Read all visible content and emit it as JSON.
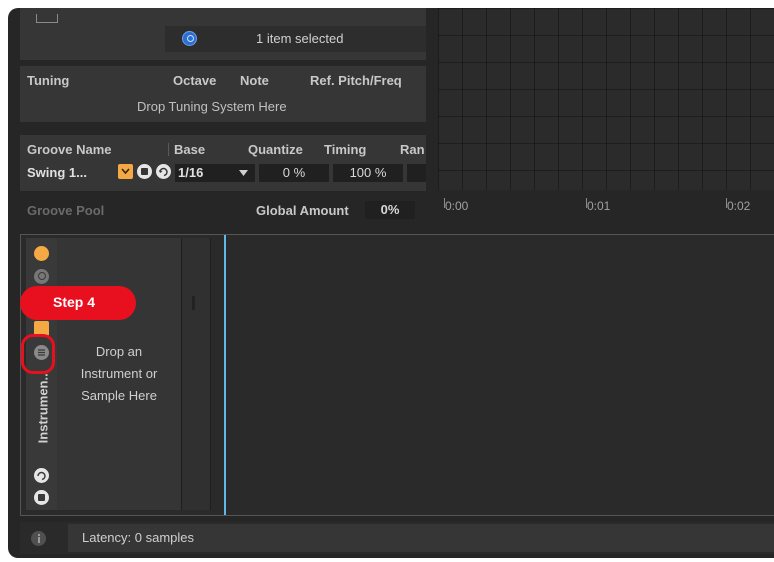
{
  "browser": {
    "selection_status": "1 item selected"
  },
  "tuning": {
    "headers": [
      "Tuning",
      "Octave",
      "Note",
      "Ref. Pitch/Freq"
    ],
    "drop_hint": "Drop Tuning System Here"
  },
  "groove": {
    "headers": [
      "Groove Name",
      "Base",
      "Quantize",
      "Timing",
      "Ran"
    ],
    "row": {
      "name": "Swing 1...",
      "base": "1/16",
      "quantize": "0 %",
      "timing": "100 %"
    },
    "pool_label": "Groove Pool",
    "global_amount_label": "Global Amount",
    "global_amount_value": "0%"
  },
  "timeline": {
    "markers": [
      "0:00",
      "0:01",
      "0:02"
    ]
  },
  "device": {
    "vertical_title": "Instrumen...",
    "drop_hint_lines": [
      "Drop an",
      "Instrument or",
      "Sample Here"
    ]
  },
  "callout": {
    "label": "Step 4",
    "color": "#e8101f"
  },
  "status": {
    "latency": "Latency: 0 samples"
  },
  "colors": {
    "accent_orange": "#f5a945",
    "selection_blue": "#2c6fd1",
    "playhead": "#5fb8e8"
  }
}
